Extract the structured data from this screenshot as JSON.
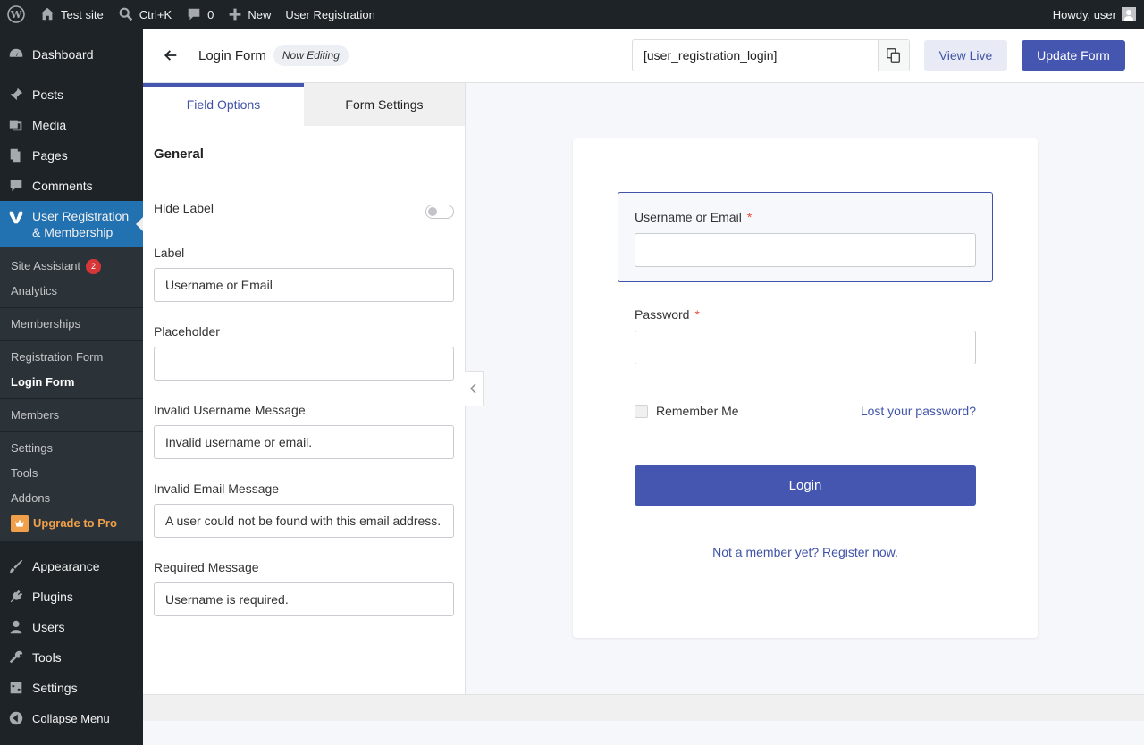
{
  "adminbar": {
    "site_name": "Test site",
    "search_shortcut": "Ctrl+K",
    "comments_count": "0",
    "new_label": "New",
    "plugin_label": "User Registration",
    "howdy": "Howdy, user"
  },
  "sidebar": {
    "dashboard": "Dashboard",
    "posts": "Posts",
    "media": "Media",
    "pages": "Pages",
    "comments": "Comments",
    "ur_line1": "User Registration",
    "ur_line2": "& Membership",
    "sub": {
      "site_assistant": "Site Assistant",
      "site_assistant_badge": "2",
      "analytics": "Analytics",
      "memberships": "Memberships",
      "registration_form": "Registration Form",
      "login_form": "Login Form",
      "members": "Members",
      "settings": "Settings",
      "tools": "Tools",
      "addons": "Addons",
      "upgrade": "Upgrade to Pro"
    },
    "appearance": "Appearance",
    "plugins": "Plugins",
    "users": "Users",
    "tools": "Tools",
    "settings": "Settings",
    "collapse": "Collapse Menu"
  },
  "header": {
    "form_name": "Login Form",
    "status": "Now Editing",
    "shortcode": "[user_registration_login]",
    "view_live": "View Live",
    "update_form": "Update Form"
  },
  "panel": {
    "tabs": [
      "Field Options",
      "Form Settings"
    ],
    "section": "General",
    "hide_label": "Hide Label",
    "label_title": "Label",
    "label_value": "Username or Email",
    "placeholder_title": "Placeholder",
    "placeholder_value": "",
    "invalid_username_title": "Invalid Username Message",
    "invalid_username_value": "Invalid username or email.",
    "invalid_email_title": "Invalid Email Message",
    "invalid_email_value": "A user could not be found with this email address.",
    "required_title": "Required Message",
    "required_value": "Username is required."
  },
  "preview": {
    "username_label": "Username or Email",
    "password_label": "Password",
    "required_mark": "*",
    "remember_me": "Remember Me",
    "lost_password": "Lost your password?",
    "login_button": "Login",
    "register_link": "Not a member yet? Register now."
  },
  "colors": {
    "accent": "#4556b0",
    "wp_blue": "#2271b1",
    "admin_dark": "#1d2327"
  }
}
